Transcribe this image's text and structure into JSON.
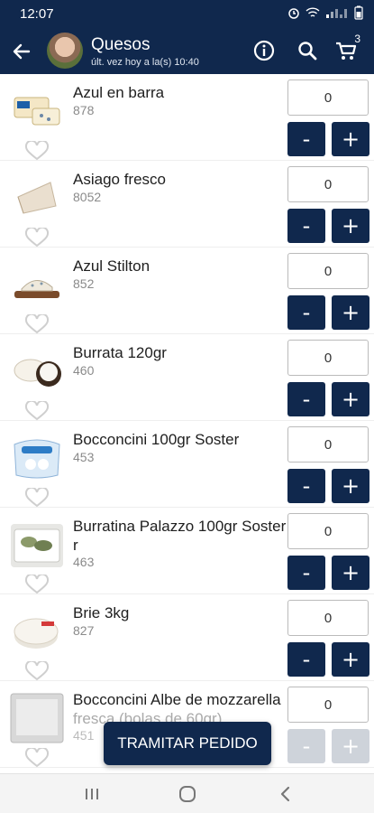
{
  "status_bar": {
    "time": "12:07"
  },
  "header": {
    "title": "Quesos",
    "subtitle": "últ. vez hoy a la(s) 10:40",
    "cart_count": "3"
  },
  "products": [
    {
      "name": "Azul en barra",
      "code": "878",
      "quantity": "0",
      "image": "blue-cheese-bar"
    },
    {
      "name": "Asiago fresco",
      "code": "8052",
      "quantity": "0",
      "image": "asiago-wedge"
    },
    {
      "name": "Azul Stilton",
      "code": "852",
      "quantity": "0",
      "image": "stilton-board"
    },
    {
      "name": "Burrata 120gr",
      "code": "460",
      "quantity": "0",
      "image": "burrata-plate"
    },
    {
      "name": "Bocconcini 100gr Soster",
      "code": "453",
      "quantity": "0",
      "image": "bocconcini-pack"
    },
    {
      "name": "Burratina Palazzo 100gr Soster",
      "name_line2": "r",
      "code": "463",
      "quantity": "0",
      "image": "burratina-tray"
    },
    {
      "name": "Brie 3kg",
      "code": "827",
      "quantity": "0",
      "image": "brie-wheel"
    },
    {
      "name": "Bocconcini Albe de mozzarella",
      "name_line2": "fresca (bolas de 60gr)",
      "code": "451",
      "quantity": "0",
      "image": "bocconcini-box"
    }
  ],
  "buttons": {
    "minus": "-",
    "plus": "+",
    "checkout": "TRAMITAR PEDIDO"
  },
  "colors": {
    "primary": "#10284d",
    "background": "#ffffff",
    "divider": "#eeeeee"
  }
}
